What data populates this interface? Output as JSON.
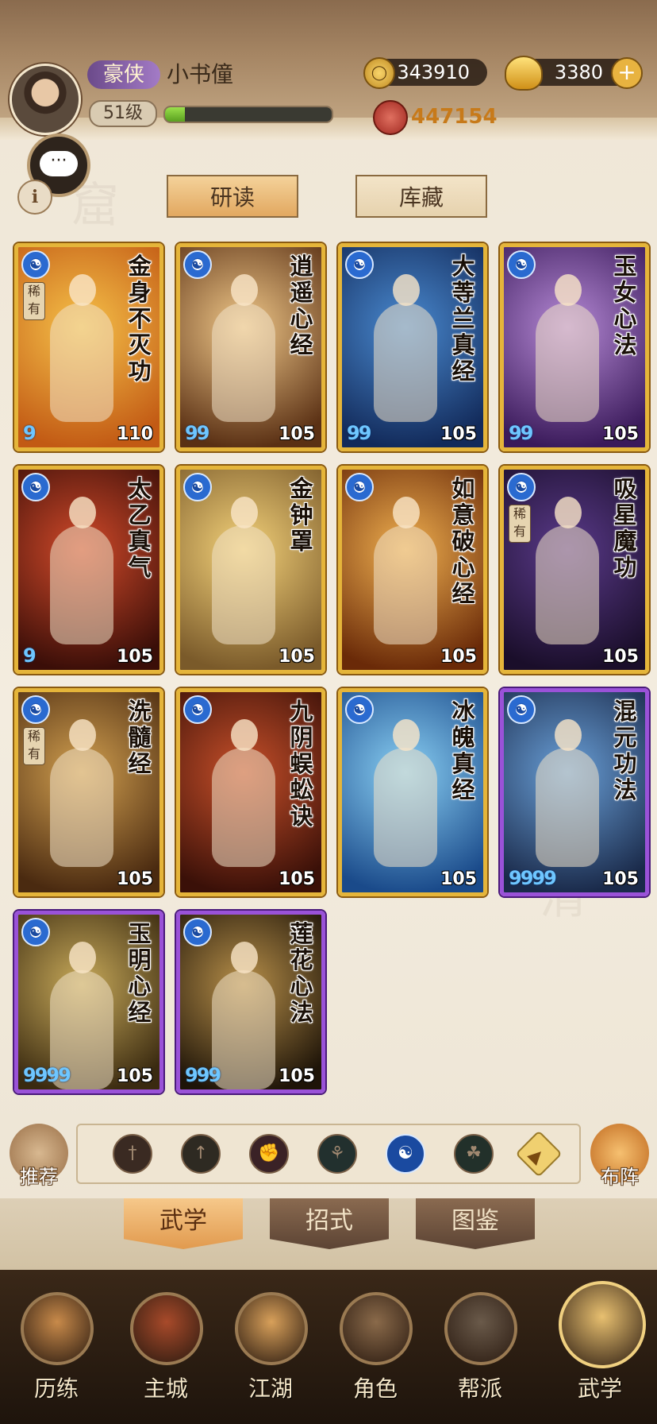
{
  "header": {
    "rank_label": "豪侠",
    "player_name": "小书僮",
    "level_label": "51级",
    "xp_fraction": 0.12,
    "coins": "343910",
    "gold": "3380",
    "add_symbol": "+",
    "power": "447154"
  },
  "chat_icon": "speech-bubble-icon",
  "info_label": "i",
  "top_tabs": {
    "study": "研读",
    "collection": "库藏"
  },
  "cards": [
    {
      "title": "金身不灭功",
      "level": "110",
      "stars": "9",
      "rare": "稀有",
      "frame": "gold",
      "palette": [
        "#f6c24a",
        "#c25a14"
      ]
    },
    {
      "title": "逍遥心经",
      "level": "105",
      "stars": "99",
      "rare": "",
      "frame": "gold",
      "palette": [
        "#f1c98a",
        "#5a3014"
      ]
    },
    {
      "title": "大䓁兰真经",
      "level": "105",
      "stars": "99",
      "rare": "",
      "frame": "gold",
      "palette": [
        "#4a8ad0",
        "#122a5a"
      ]
    },
    {
      "title": "玉女心法",
      "level": "105",
      "stars": "99",
      "rare": "",
      "frame": "gold",
      "palette": [
        "#b68ad6",
        "#3a1a5a"
      ]
    },
    {
      "title": "太乙真气",
      "level": "105",
      "stars": "9",
      "rare": "",
      "frame": "gold",
      "palette": [
        "#d24a2a",
        "#3a0e08"
      ]
    },
    {
      "title": "金钟罩",
      "level": "105",
      "stars": "",
      "rare": "",
      "frame": "gold",
      "palette": [
        "#f4d27a",
        "#7a5a2a"
      ]
    },
    {
      "title": "如意破心经",
      "level": "105",
      "stars": "",
      "rare": "",
      "frame": "gold",
      "palette": [
        "#f0b050",
        "#6a2a08"
      ]
    },
    {
      "title": "吸星魔功",
      "level": "105",
      "stars": "",
      "rare": "稀有",
      "frame": "gold",
      "palette": [
        "#5a3a8a",
        "#1a0e2a"
      ]
    },
    {
      "title": "洗髓经",
      "level": "105",
      "stars": "",
      "rare": "稀有",
      "frame": "gold",
      "palette": [
        "#d2a050",
        "#4a2a10"
      ]
    },
    {
      "title": "九阴蜈蚣诀",
      "level": "105",
      "stars": "",
      "rare": "",
      "frame": "gold",
      "palette": [
        "#c8502a",
        "#3a1008"
      ]
    },
    {
      "title": "冰魄真经",
      "level": "105",
      "stars": "",
      "rare": "",
      "frame": "gold",
      "palette": [
        "#8ad0f4",
        "#1a4a8a"
      ]
    },
    {
      "title": "混元功法",
      "level": "105",
      "stars": "9999",
      "rare": "",
      "frame": "purple",
      "palette": [
        "#6aa0d8",
        "#1a2a4a"
      ]
    },
    {
      "title": "玉明心经",
      "level": "105",
      "stars": "9999",
      "rare": "",
      "frame": "purple",
      "palette": [
        "#c8aa5a",
        "#3a2a10"
      ]
    },
    {
      "title": "莲花心法",
      "level": "105",
      "stars": "999",
      "rare": "",
      "frame": "purple",
      "palette": [
        "#b8904a",
        "#1e1408"
      ]
    }
  ],
  "filter": {
    "recommend_label": "推荐",
    "formation_label": "布阵",
    "icons": [
      "sword-filter-icon",
      "arrow-filter-icon",
      "fist-filter-icon",
      "palm-filter-icon",
      "taiji-filter-icon",
      "shield-filter-icon",
      "collapse-arrow-icon"
    ]
  },
  "sub_tabs": {
    "martial": "武学",
    "moves": "招式",
    "atlas": "图鉴"
  },
  "bottom_nav": [
    {
      "label": "历练",
      "color": "#c88a4a"
    },
    {
      "label": "主城",
      "color": "#a84a2a"
    },
    {
      "label": "江湖",
      "color": "#d8a05a"
    },
    {
      "label": "角色",
      "color": "#8a6a4a"
    },
    {
      "label": "帮派",
      "color": "#6a5a4a"
    },
    {
      "label": "武学",
      "color": "#e8c070"
    }
  ]
}
